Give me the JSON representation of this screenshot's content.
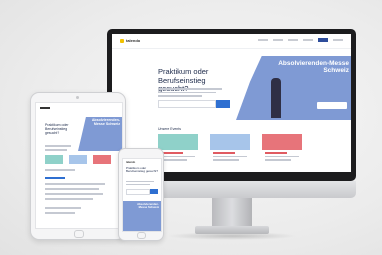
{
  "desktop": {
    "logo": "talendo",
    "hero_title": "Praktikum oder Berufseinstieg gesucht?",
    "banner_title": "Absolvierenden-Messe Schweiz",
    "events_heading": "Unsere Events"
  },
  "tablet": {
    "hero_title": "Praktikum oder Berufseinstieg gesucht?",
    "banner_title": "Absolvierenden-Messe Schweiz"
  },
  "phone": {
    "logo": "talendo",
    "hero_title": "Praktikum oder Berufseinstieg gesucht?",
    "banner_title": "Absolvierenden-Messe Schweiz"
  },
  "colors": {
    "brand_blue": "#2e4d9b",
    "banner_blue": "#7f9ad4",
    "card_teal": "#8fd1c9",
    "card_blue": "#a7c5ea",
    "card_red": "#e7747a",
    "logo_yellow": "#f2c200"
  }
}
